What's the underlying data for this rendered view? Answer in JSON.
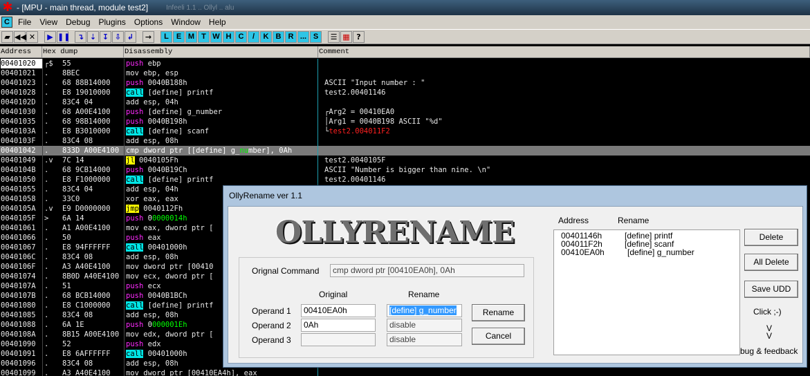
{
  "window": {
    "title": "- [MPU - main thread, module test2]",
    "ghost_tabs": "Infeeli 1.1 .. Ollyl .. alu"
  },
  "menu": {
    "cpu_icon": "C",
    "items": [
      "File",
      "View",
      "Debug",
      "Plugins",
      "Options",
      "Window",
      "Help"
    ]
  },
  "toolbar": {
    "nav_buttons": [
      "open-icon",
      "rewind-icon",
      "close-icon",
      "run-icon",
      "pause-icon",
      "step-into-icon",
      "step-over-icon",
      "trace-into-icon",
      "trace-over-icon",
      "execute-till-return-icon",
      "goto-icon"
    ],
    "letter_buttons": [
      "L",
      "E",
      "M",
      "T",
      "W",
      "H",
      "C",
      "/",
      "K",
      "B",
      "R",
      "...",
      "S"
    ],
    "extra_buttons": [
      "list-icon",
      "grid-icon",
      "help-icon"
    ]
  },
  "columns": {
    "address": "Address",
    "hex": "Hex dump",
    "disassembly": "Disassembly",
    "comment": "Comment"
  },
  "rows": [
    {
      "addr": "00401020",
      "mark": "┌$",
      "hex": "55",
      "dis": [
        [
          "push",
          "push"
        ],
        [
          "t",
          " ebp"
        ]
      ],
      "com": []
    },
    {
      "addr": "00401021",
      "mark": ".",
      "hex": "8BEC",
      "dis": [
        [
          "t",
          "mov ebp, esp"
        ]
      ],
      "com": []
    },
    {
      "addr": "00401023",
      "mark": ".",
      "hex": "68 88B14000",
      "dis": [
        [
          "push",
          "push"
        ],
        [
          "t",
          " 0040B188h"
        ]
      ],
      "com": [
        [
          "t",
          "ASCII \"Input number : \""
        ]
      ]
    },
    {
      "addr": "00401028",
      "mark": ".",
      "hex": "E8 19010000",
      "dis": [
        [
          "call",
          "call"
        ],
        [
          "t",
          " [define] printf"
        ]
      ],
      "com": [
        [
          "t",
          "test2.00401146"
        ]
      ]
    },
    {
      "addr": "0040102D",
      "mark": ".",
      "hex": "83C4 04",
      "dis": [
        [
          "t",
          "add esp, 04h"
        ]
      ],
      "com": []
    },
    {
      "addr": "00401030",
      "mark": ".",
      "hex": "68 A00E4100",
      "dis": [
        [
          "push",
          "push"
        ],
        [
          "t",
          " [define] g_number"
        ]
      ],
      "com": [
        [
          "t",
          "┌Arg2 = 00410EA0"
        ]
      ]
    },
    {
      "addr": "00401035",
      "mark": ".",
      "hex": "68 98B14000",
      "dis": [
        [
          "push",
          "push"
        ],
        [
          "t",
          " 0040B198h"
        ]
      ],
      "com": [
        [
          "t",
          "│Arg1 = 0040B198 ASCII \"%d\""
        ]
      ]
    },
    {
      "addr": "0040103A",
      "mark": ".",
      "hex": "E8 B3010000",
      "dis": [
        [
          "call",
          "call"
        ],
        [
          "t",
          " [define] scanf"
        ]
      ],
      "com": [
        [
          "t",
          "└"
        ],
        [
          "red",
          "test2.004011F2"
        ]
      ]
    },
    {
      "addr": "0040103F",
      "mark": ".",
      "hex": "83C4 08",
      "dis": [
        [
          "t",
          "add esp, 08h"
        ]
      ],
      "com": []
    },
    {
      "addr": "00401042",
      "mark": ".",
      "hex": "833D A00E4100",
      "dis": [
        [
          "t",
          "cmp dword ptr [[define] g_"
        ],
        [
          "green",
          "nu"
        ],
        [
          "t",
          "mber], 0Ah"
        ]
      ],
      "com": [],
      "current": true
    },
    {
      "addr": "00401049",
      "mark": ".v",
      "hex": "7C 14",
      "dis": [
        [
          "jmp",
          "jl"
        ],
        [
          "t",
          " 0040105Fh"
        ]
      ],
      "com": [
        [
          "t",
          "test2.0040105F"
        ]
      ]
    },
    {
      "addr": "0040104B",
      "mark": ".",
      "hex": "68 9CB14000",
      "dis": [
        [
          "push",
          "push"
        ],
        [
          "t",
          " 0040B19Ch"
        ]
      ],
      "com": [
        [
          "t",
          "ASCII \"Number is bigger than nine. \\n\""
        ]
      ]
    },
    {
      "addr": "00401050",
      "mark": ".",
      "hex": "E8 F1000000",
      "dis": [
        [
          "call",
          "call"
        ],
        [
          "t",
          " [define] printf"
        ]
      ],
      "com": [
        [
          "t",
          "test2.00401146"
        ]
      ]
    },
    {
      "addr": "00401055",
      "mark": ".",
      "hex": "83C4 04",
      "dis": [
        [
          "t",
          "add esp, 04h"
        ]
      ],
      "com": []
    },
    {
      "addr": "00401058",
      "mark": ".",
      "hex": "33C0",
      "dis": [
        [
          "t",
          "xor eax, eax"
        ]
      ],
      "com": []
    },
    {
      "addr": "0040105A",
      "mark": ".v",
      "hex": "E9 D0000000",
      "dis": [
        [
          "jmp",
          "jmp"
        ],
        [
          "t",
          " 0040112Fh"
        ]
      ],
      "com": []
    },
    {
      "addr": "0040105F",
      "mark": ">",
      "hex": "6A 14",
      "dis": [
        [
          "push",
          "push"
        ],
        [
          "t",
          " 0"
        ],
        [
          "green",
          "0000014h"
        ]
      ],
      "com": []
    },
    {
      "addr": "00401061",
      "mark": ".",
      "hex": "A1 A00E4100",
      "dis": [
        [
          "t",
          "mov eax, dword ptr ["
        ]
      ],
      "com": []
    },
    {
      "addr": "00401066",
      "mark": ".",
      "hex": "50",
      "dis": [
        [
          "push",
          "push"
        ],
        [
          "t",
          " eax"
        ]
      ],
      "com": []
    },
    {
      "addr": "00401067",
      "mark": ".",
      "hex": "E8 94FFFFFF",
      "dis": [
        [
          "call",
          "call"
        ],
        [
          "t",
          " 00401000h"
        ]
      ],
      "com": []
    },
    {
      "addr": "0040106C",
      "mark": ".",
      "hex": "83C4 08",
      "dis": [
        [
          "t",
          "add esp, 08h"
        ]
      ],
      "com": []
    },
    {
      "addr": "0040106F",
      "mark": ".",
      "hex": "A3 A40E4100",
      "dis": [
        [
          "t",
          "mov dword ptr [00410"
        ]
      ],
      "com": []
    },
    {
      "addr": "00401074",
      "mark": ".",
      "hex": "8B0D A40E4100",
      "dis": [
        [
          "t",
          "mov ecx, dword ptr ["
        ]
      ],
      "com": []
    },
    {
      "addr": "0040107A",
      "mark": ".",
      "hex": "51",
      "dis": [
        [
          "push",
          "push"
        ],
        [
          "t",
          " ecx"
        ]
      ],
      "com": []
    },
    {
      "addr": "0040107B",
      "mark": ".",
      "hex": "68 BCB14000",
      "dis": [
        [
          "push",
          "push"
        ],
        [
          "t",
          " 0040B1BCh"
        ]
      ],
      "com": []
    },
    {
      "addr": "00401080",
      "mark": ".",
      "hex": "E8 C1000000",
      "dis": [
        [
          "call",
          "call"
        ],
        [
          "t",
          " [define] printf"
        ]
      ],
      "com": []
    },
    {
      "addr": "00401085",
      "mark": ".",
      "hex": "83C4 08",
      "dis": [
        [
          "t",
          "add esp, 08h"
        ]
      ],
      "com": []
    },
    {
      "addr": "00401088",
      "mark": ".",
      "hex": "6A 1E",
      "dis": [
        [
          "push",
          "push"
        ],
        [
          "t",
          " 0"
        ],
        [
          "green",
          "000001Eh"
        ]
      ],
      "com": []
    },
    {
      "addr": "0040108A",
      "mark": ".",
      "hex": "8B15 A00E4100",
      "dis": [
        [
          "t",
          "mov edx, dword ptr ["
        ]
      ],
      "com": []
    },
    {
      "addr": "00401090",
      "mark": ".",
      "hex": "52",
      "dis": [
        [
          "push",
          "push"
        ],
        [
          "t",
          " edx"
        ]
      ],
      "com": []
    },
    {
      "addr": "00401091",
      "mark": ".",
      "hex": "E8 6AFFFFFF",
      "dis": [
        [
          "call",
          "call"
        ],
        [
          "t",
          " 00401000h"
        ]
      ],
      "com": []
    },
    {
      "addr": "00401096",
      "mark": ".",
      "hex": "83C4 08",
      "dis": [
        [
          "t",
          "add esp, 08h"
        ]
      ],
      "com": []
    },
    {
      "addr": "00401099",
      "mark": ".",
      "hex": "A3 A40E4100",
      "dis": [
        [
          "t",
          "mov dword ptr [00410EA4h], eax"
        ]
      ],
      "com": []
    }
  ],
  "dialog": {
    "title": "OllyRename ver 1.1",
    "logo": "OLLYRENAME",
    "original_command_label": "Orignal Command",
    "original_command_value": "cmp dword ptr [00410EA0h], 0Ah",
    "col_original": "Original",
    "col_rename": "Rename",
    "operands": [
      {
        "label": "Operand 1",
        "original": "00410EA0h",
        "rename": "[define] g_number"
      },
      {
        "label": "Operand 2",
        "original": "0Ah",
        "rename": "disable"
      },
      {
        "label": "Operand 3",
        "original": "",
        "rename": "disable"
      }
    ],
    "rename_button": "Rename",
    "cancel_button": "Cancel",
    "list_header_address": "Address",
    "list_header_rename": "Rename",
    "list_items": [
      {
        "address": "00401146h",
        "rename": "[define] printf"
      },
      {
        "address": "004011F2h",
        "rename": "[define] scanf"
      },
      {
        "address": "00410EA0h",
        "rename": "[define] g_number"
      }
    ],
    "delete_button": "Delete",
    "all_delete_button": "All Delete",
    "save_udd_button": "Save UDD",
    "click_text": "Click ;-)",
    "arrow1": "V",
    "arrow2": "V",
    "feedback_text": "bug & feedback"
  }
}
